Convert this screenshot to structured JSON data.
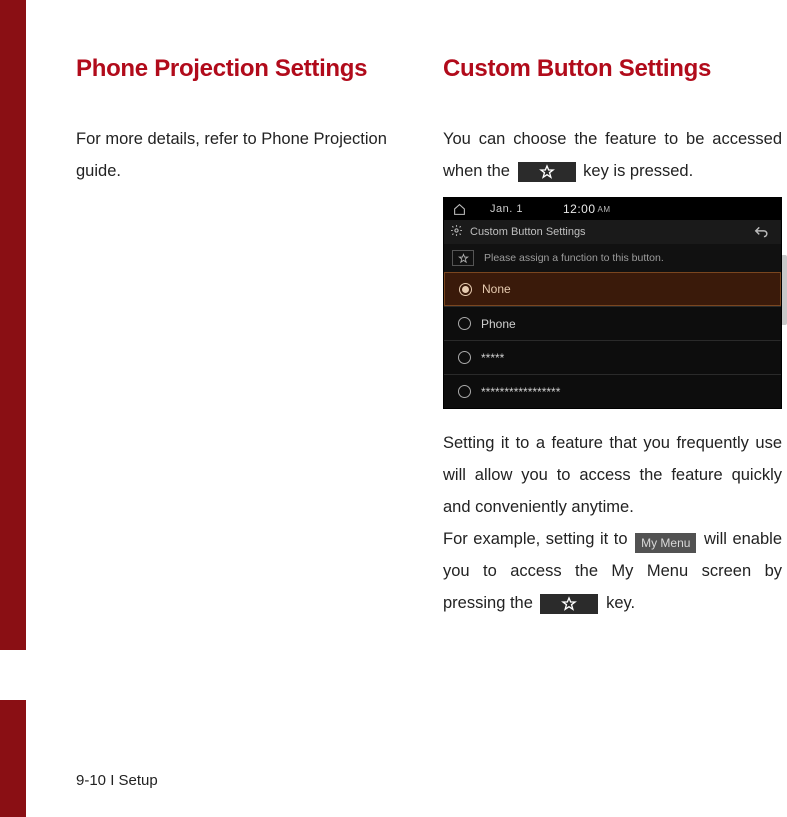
{
  "left": {
    "title": "Phone Projection Settings",
    "para": "For more details, refer to Phone Projection guide."
  },
  "right": {
    "title": "Custom Button Settings",
    "intro_a": "You can choose the feature to be accessed when the ",
    "intro_b": " key is pressed.",
    "para2": "Setting it to a feature that you frequently use will allow you to access the feature quickly and conveniently anytime.",
    "ex_a": "For example, setting it to ",
    "ex_b": " will enable you to access the My Menu screen by pressing the ",
    "ex_c": " key.",
    "mymenu_label": "My Menu"
  },
  "device": {
    "date": "Jan. 1",
    "time": "12:00",
    "ampm": "AM",
    "screen_title": "Custom Button Settings",
    "hint": "Please assign a function to this button.",
    "options": [
      "None",
      "Phone",
      "*****",
      "*****************"
    ],
    "selected_index": 0
  },
  "footer": "9-10 I Setup"
}
